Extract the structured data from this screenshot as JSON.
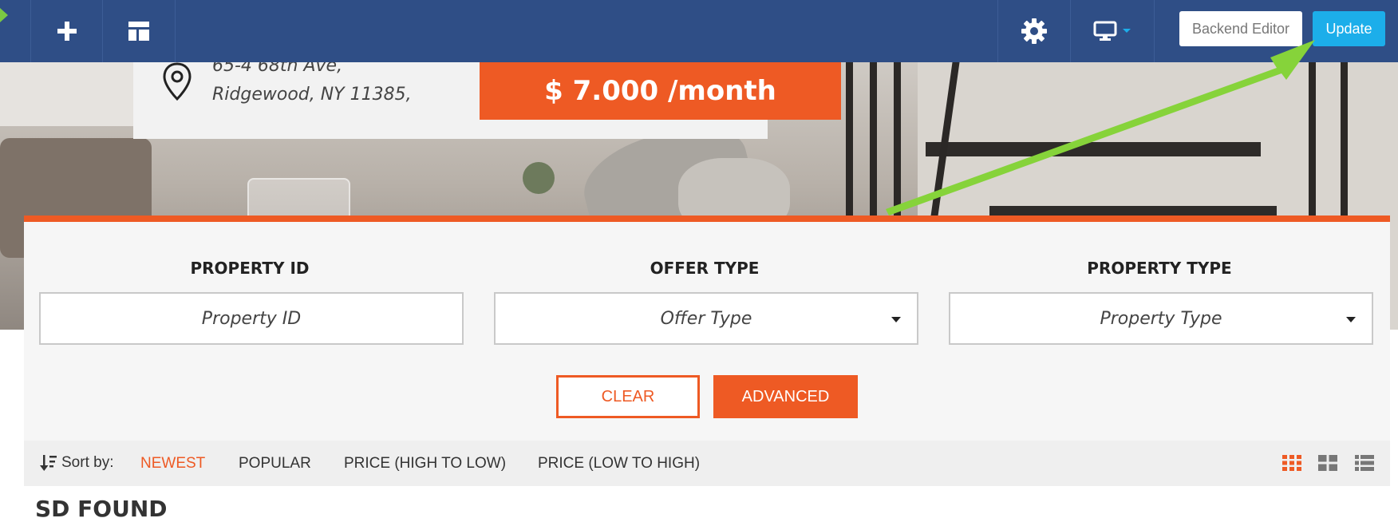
{
  "toolbar": {
    "add_icon": "plus-icon",
    "layout_icon": "layout-icon",
    "settings_icon": "gear-icon",
    "device_icon": "desktop-icon",
    "backend_editor_label": "Backend Editor",
    "update_label": "Update",
    "color": "#2f4e86",
    "update_color": "#1caeea"
  },
  "listing": {
    "address_line1": "65-4 68th Ave,",
    "address_line2": "Ridgewood, NY 11385,",
    "price": "$ 7.000 /month",
    "accent_color": "#ee5a24"
  },
  "search": {
    "fields": [
      {
        "label": "PROPERTY ID",
        "value": "Property ID"
      },
      {
        "label": "OFFER TYPE",
        "value": "Offer Type"
      },
      {
        "label": "PROPERTY TYPE",
        "value": "Property Type"
      }
    ],
    "clear_label": "CLEAR",
    "advanced_label": "ADVANCED"
  },
  "sort": {
    "label": "Sort by:",
    "options": [
      "NEWEST",
      "POPULAR",
      "PRICE (HIGH TO LOW)",
      "PRICE (LOW TO HIGH)"
    ],
    "active": "NEWEST",
    "views": [
      "grid-small-icon",
      "grid-large-icon",
      "list-icon"
    ]
  },
  "results": {
    "found_text": "SD FOUND"
  }
}
